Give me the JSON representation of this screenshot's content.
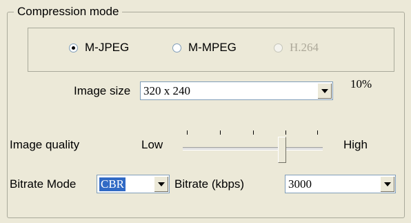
{
  "group": {
    "title": "Compression mode"
  },
  "codec": {
    "options": [
      {
        "label": "M-JPEG",
        "checked": true,
        "enabled": true
      },
      {
        "label": "M-MPEG",
        "checked": false,
        "enabled": true
      },
      {
        "label": "H.264",
        "checked": false,
        "enabled": false
      }
    ]
  },
  "image_size": {
    "label": "Image size",
    "value": "320 x 240",
    "percent": "10%"
  },
  "image_quality": {
    "label": "Image quality",
    "low_label": "Low",
    "high_label": "High",
    "level": 0.75
  },
  "bitrate_mode": {
    "label": "Bitrate Mode",
    "value": "CBR"
  },
  "bitrate": {
    "label": "Bitrate (kbps)",
    "value": "3000"
  }
}
